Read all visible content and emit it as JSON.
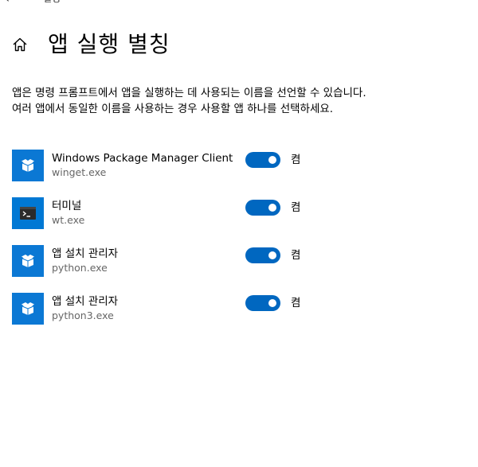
{
  "topbar": {
    "back_glyph": "‹",
    "caption": "설정"
  },
  "header": {
    "home_icon": "home-icon",
    "title": "앱 실행 별칭"
  },
  "description": "앱은 명령 프롬프트에서 앱을 실행하는 데 사용되는 이름을 선언할 수 있습니다. 여러 앱에서 동일한 이름을 사용하는 경우 사용할 앱 하나를 선택하세요.",
  "colors": {
    "accent": "#0067c0",
    "icon_bg": "#0b78d4",
    "secondary_text": "#666666"
  },
  "apps": [
    {
      "name": "Windows Package Manager Client",
      "exe": "winget.exe",
      "icon": "package-icon",
      "enabled": true,
      "state_label": "켬"
    },
    {
      "name": "터미널",
      "exe": "wt.exe",
      "icon": "terminal-icon",
      "enabled": true,
      "state_label": "켬"
    },
    {
      "name": "앱 설치 관리자",
      "exe": "python.exe",
      "icon": "package-icon",
      "enabled": true,
      "state_label": "켬"
    },
    {
      "name": "앱 설치 관리자",
      "exe": "python3.exe",
      "icon": "package-icon",
      "enabled": true,
      "state_label": "켬"
    }
  ]
}
